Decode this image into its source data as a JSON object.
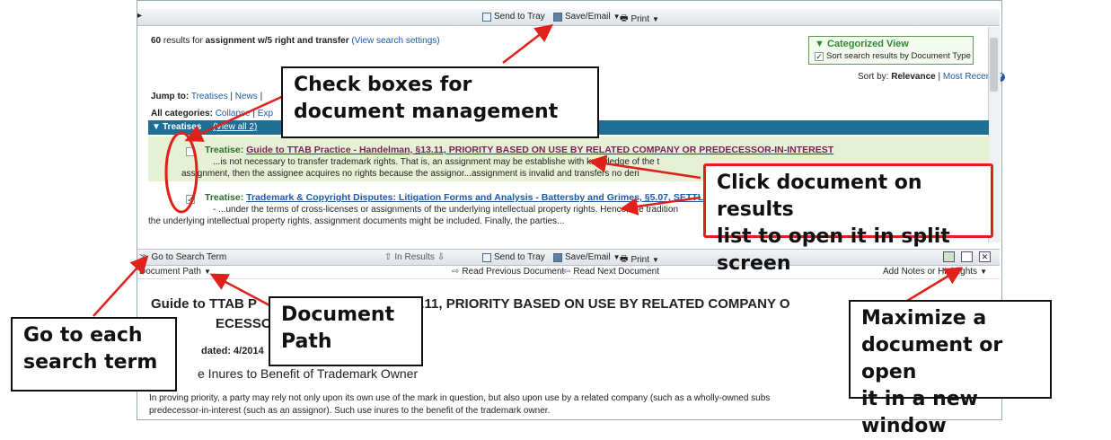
{
  "toolbar": {
    "send_to_tray": "Send to Tray",
    "save_email": "Save/Email",
    "print": "Print"
  },
  "results": {
    "count": "60",
    "text": "results for",
    "query": "assignment w/5 right and transfer",
    "view_settings": "(View search settings)"
  },
  "categorized": {
    "title": "Categorized View",
    "checkbox_label": "Sort search results by Document Type"
  },
  "sort": {
    "label": "Sort by:",
    "relevance": "Relevance",
    "separator": "|",
    "most_recent": "Most Recent"
  },
  "jump_to": {
    "label": "Jump to:",
    "treatises": "Treatises",
    "separator": "|",
    "news": "News",
    "tail": "|"
  },
  "categories": {
    "label": "All categories:",
    "collapse": "Collapse",
    "separator": "|",
    "expand": "Exp"
  },
  "treatises_bar": {
    "label": "Treatises",
    "view_all": "(View all 2)"
  },
  "result1": {
    "type": "Treatise:",
    "title": "Guide to TTAB Practice - Handelman, §13.11, PRIORITY BASED ON USE BY RELATED COMPANY OR PREDECESSOR-IN-INTEREST",
    "line1": "...is not necessary to transfer trademark rights. That is, an assignment may be establishe with knowledge of the t",
    "line2": "assignment, then the assignee acquires no rights because the assignor...assignment is invalid and transfers no deri"
  },
  "result2": {
    "type": "Treatise:",
    "title": "Trademark & Copyright Disputes: Litigation Forms and Analysis - Battersby and Grimes, §5.07, SETTLEMENT",
    "line1": "- ...under the terms of cross-licenses or assignments of the underlying intellectual property rights. Hence, the tradition",
    "line2": "the underlying intellectual property rights, assignment documents might be included. Finally, the parties..."
  },
  "split_bar": {
    "go_to_search_term": "Go to Search Term",
    "in_results": "In Results",
    "send_to_tray": "Send to Tray",
    "save_email": "Save/Email",
    "print": "Print"
  },
  "doc_bar": {
    "document_path": "Document Path",
    "read_previous": "Read Previous Document",
    "read_next": "Read Next Document",
    "add_notes": "Add Notes or Highlights"
  },
  "document": {
    "title_a": "Guide to TTAB P",
    "title_b": "3.11, PRIORITY BASED ON USE BY RELATED COMPANY O",
    "title_line2": "ECESSOR",
    "updated": "dated: 4/2014",
    "section_heading": "e Inures to Benefit of Trademark Owner",
    "para1": "In proving priority, a party may rely not only upon its own use of the mark in question, but also upon use by a related company (such as a wholly-owned subs",
    "para2": "predecessor-in-interest (such as an assignor). Such use inures to the benefit of the trademark owner."
  },
  "callouts": {
    "checkboxes": [
      "Check boxes for",
      "document management"
    ],
    "click_doc": [
      "Click document on results",
      "list to open it in split screen"
    ],
    "doc_path": [
      "Document",
      "Path"
    ],
    "go_to_term": [
      "Go to each",
      "search term"
    ],
    "maximize": [
      "Maximize a",
      "document or open",
      "it in a new window"
    ]
  },
  "colors": {
    "annotation_red": "#e0201a",
    "category_bar": "#1f6f94",
    "highlight_row": "#e6f0d4",
    "link": "#1a5aa6",
    "category_green": "#2f8a2f"
  }
}
